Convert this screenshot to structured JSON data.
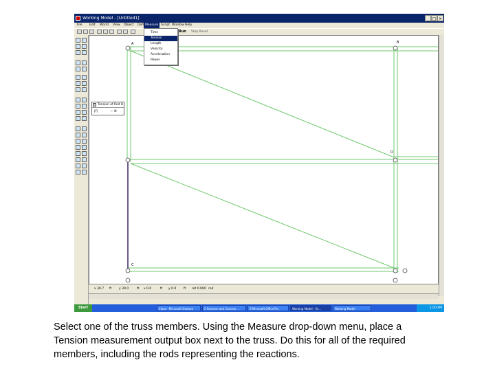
{
  "window": {
    "title": "Working Model - [Untitled1]",
    "controls": [
      "_",
      "□",
      "×"
    ]
  },
  "menubar": {
    "items": [
      "File",
      "Edit",
      "World",
      "View",
      "Object",
      "Define",
      "Measure",
      "Script",
      "Window",
      "Help"
    ],
    "open_menu": "Measure"
  },
  "toolbar": {
    "run_label": "Run",
    "stop_info": "Stop  Reset"
  },
  "measure_menu": {
    "items": [
      "Time",
      "Tension",
      "Length",
      "Velocity",
      "Acceleration",
      "Power"
    ],
    "selected": "Tension"
  },
  "measurement_box": {
    "title": "Tension of Rod 8",
    "label": "|F|",
    "value": "--- N"
  },
  "points": {
    "A": "A",
    "B": "B",
    "C": "C",
    "D": "D"
  },
  "coordbar": {
    "x": "x 30.7",
    "fr": "ft",
    "y": "y 30.0",
    "ft2": "ft",
    "vx": "x 0.0",
    "ft3": "ft",
    "vy": "y 0.0",
    "ft4": "ft",
    "rot": "rot 0.000",
    "unit": "rad"
  },
  "taskbar": {
    "start": "Start",
    "items": [
      "Inbox - Microsoft Outlook",
      "2 Scanner and Camera ...",
      "3 Microsoft Office Po...",
      "Working Model - [U...",
      "Working Model"
    ],
    "clock": "1:00 PM"
  },
  "caption": {
    "line1": "Select one of the truss members. Using the Measure drop-down menu, place a",
    "line2": "Tension measurement output box next to the truss. Do this for all of the required",
    "line3": "members, including the rods representing the reactions."
  },
  "colors": {
    "truss_member": "#6cc96c",
    "selected_member": "#3a2560",
    "titlebar": "#0a246a",
    "taskbar": "#245edb"
  }
}
